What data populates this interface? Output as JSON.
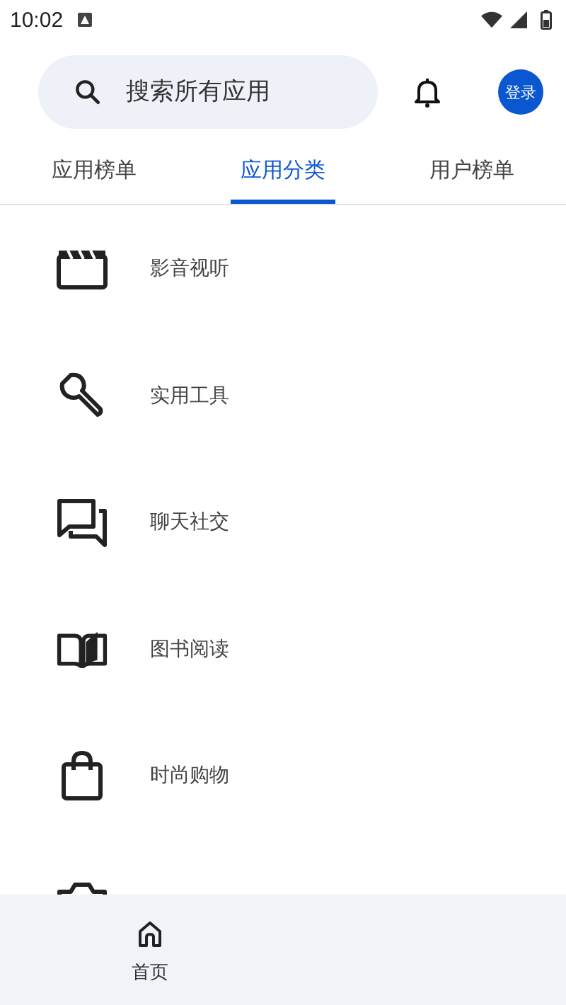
{
  "status_bar": {
    "time": "10:02"
  },
  "search": {
    "placeholder": "搜索所有应用"
  },
  "login_button": "登录",
  "tabs": [
    {
      "label": "应用榜单",
      "selected": false
    },
    {
      "label": "应用分类",
      "selected": true
    },
    {
      "label": "用户榜单",
      "selected": false
    }
  ],
  "categories": [
    {
      "kind": "film",
      "label": "影音视听"
    },
    {
      "kind": "tools",
      "label": "实用工具"
    },
    {
      "kind": "chat",
      "label": "聊天社交"
    },
    {
      "kind": "book",
      "label": "图书阅读"
    },
    {
      "kind": "shopping",
      "label": "时尚购物"
    },
    {
      "kind": "camera"
    }
  ],
  "bottom_nav": [
    {
      "kind": "home",
      "label": "首页",
      "selected": true
    }
  ]
}
